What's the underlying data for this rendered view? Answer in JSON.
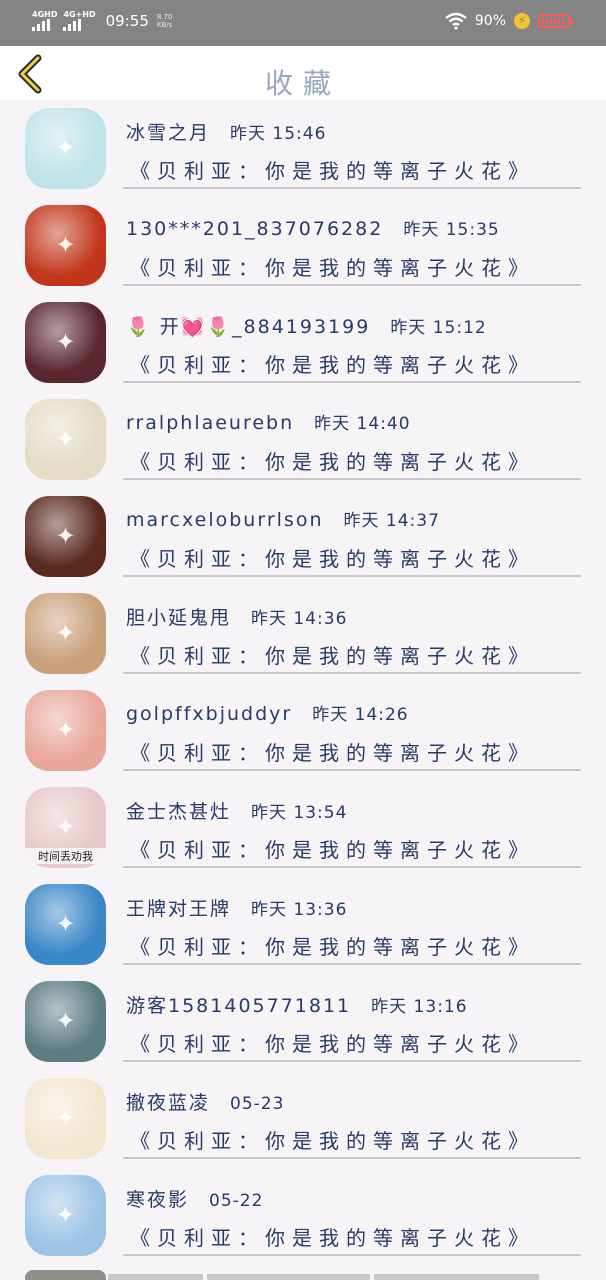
{
  "status_bar": {
    "signal1_label": "4GHD",
    "signal2_label": "4G+HD",
    "time": "09:55",
    "speed_value": "8.70",
    "speed_unit": "KB/s",
    "battery_percent": "90%",
    "battery_level": 0.9
  },
  "header": {
    "title": "收藏"
  },
  "favorites": [
    {
      "name": "冰雪之月",
      "time": "昨天 15:46",
      "content": "《贝利亚：你是我的等离子火花》",
      "avatar_color": "#bfe3e8",
      "avatar_icon": "anime-girl-icon"
    },
    {
      "name": "130***201_837076282",
      "time": "昨天 15:35",
      "content": "《贝利亚：你是我的等离子火花》",
      "avatar_color": "#c2371c",
      "avatar_icon": "game-banner-icon"
    },
    {
      "name": "🌷 开💓🌷_884193199",
      "time": "昨天 15:12",
      "content": "《贝利亚：你是我的等离子火花》",
      "avatar_color": "#5a2630",
      "avatar_icon": "fox-girl-icon"
    },
    {
      "name": "rralphlaeurebn",
      "time": "昨天 14:40",
      "content": "《贝利亚：你是我的等离子火花》",
      "avatar_color": "#e4dcc4",
      "avatar_icon": "cartoon-pair-icon"
    },
    {
      "name": "marcxeloburrlson",
      "time": "昨天 14:37",
      "content": "《贝利亚：你是我的等离子火花》",
      "avatar_color": "#5a2a1e",
      "avatar_icon": "portrait-icon"
    },
    {
      "name": "胆小延鬼甩",
      "time": "昨天 14:36",
      "content": "《贝利亚：你是我的等离子火花》",
      "avatar_color": "#c9a07a",
      "avatar_icon": "noodles-icon"
    },
    {
      "name": "golpffxbjuddyr",
      "time": "昨天 14:26",
      "content": "《贝利亚：你是我的等离子火花》",
      "avatar_color": "#e9a79a",
      "avatar_icon": "grill-icon"
    },
    {
      "name": "金士杰甚灶",
      "time": "昨天 13:54",
      "content": "《贝利亚：你是我的等离子火花》",
      "avatar_color": "#e8c8c8",
      "avatar_icon": "portrait-icon",
      "avatar_caption": "时间丢劝我"
    },
    {
      "name": "王牌对王牌",
      "time": "昨天 13:36",
      "content": "《贝利亚：你是我的等离子火花》",
      "avatar_color": "#3a87c8",
      "avatar_icon": "ship-icon"
    },
    {
      "name": "游客1581405771811",
      "time": "昨天 13:16",
      "content": "《贝利亚：你是我的等离子火花》",
      "avatar_color": "#5c7c84",
      "avatar_icon": "anime-boy-icon"
    },
    {
      "name": "撤夜蓝凌",
      "time": "05-23",
      "content": "《贝利亚：你是我的等离子火花》",
      "avatar_color": "#f3e6cf",
      "avatar_icon": "fox-girl-icon"
    },
    {
      "name": "寒夜影",
      "time": "05-22",
      "content": "《贝利亚：你是我的等离子火花》",
      "avatar_color": "#9cc3e6",
      "avatar_icon": "anime-boy-icon"
    }
  ]
}
